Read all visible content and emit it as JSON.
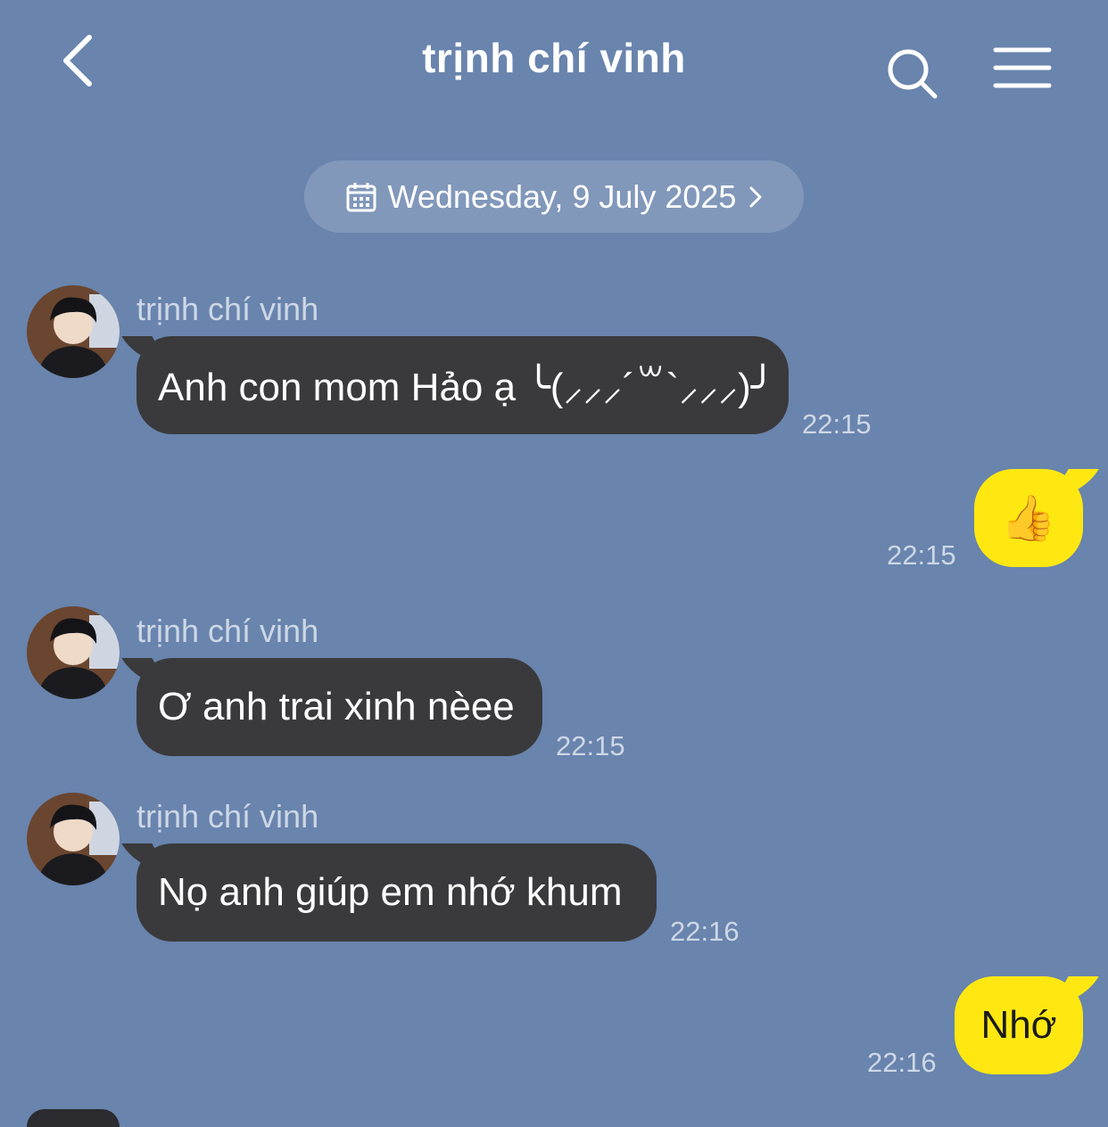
{
  "header": {
    "title": "trịnh chí vinh",
    "back_icon": "chevron-left-icon",
    "search_icon": "search-icon",
    "menu_icon": "menu-icon"
  },
  "date_separator": {
    "label": "Wednesday, 9 July 2025",
    "icon": "calendar-icon",
    "chevron": "chevron-right-icon"
  },
  "colors": {
    "background": "#6984ad",
    "incoming_bubble": "#3a3a3c",
    "outgoing_bubble": "#ffe811",
    "date_pill": "#8198bb"
  },
  "messages": [
    {
      "direction": "incoming",
      "sender": "trịnh chí vinh",
      "text": "Anh con mom Hảo ạ ╰(⸝⸝⸝´꒳`⸝⸝⸝)╯",
      "time": "22:15"
    },
    {
      "direction": "outgoing",
      "text": "👍",
      "time": "22:15"
    },
    {
      "direction": "incoming",
      "sender": "trịnh chí vinh",
      "text": "Ơ anh trai xinh nèee",
      "time": "22:15"
    },
    {
      "direction": "incoming",
      "sender": "trịnh chí vinh",
      "text": "Nọ anh giúp em nhớ khum",
      "time": "22:16"
    },
    {
      "direction": "outgoing",
      "text": "Nhớ",
      "time": "22:16"
    }
  ]
}
